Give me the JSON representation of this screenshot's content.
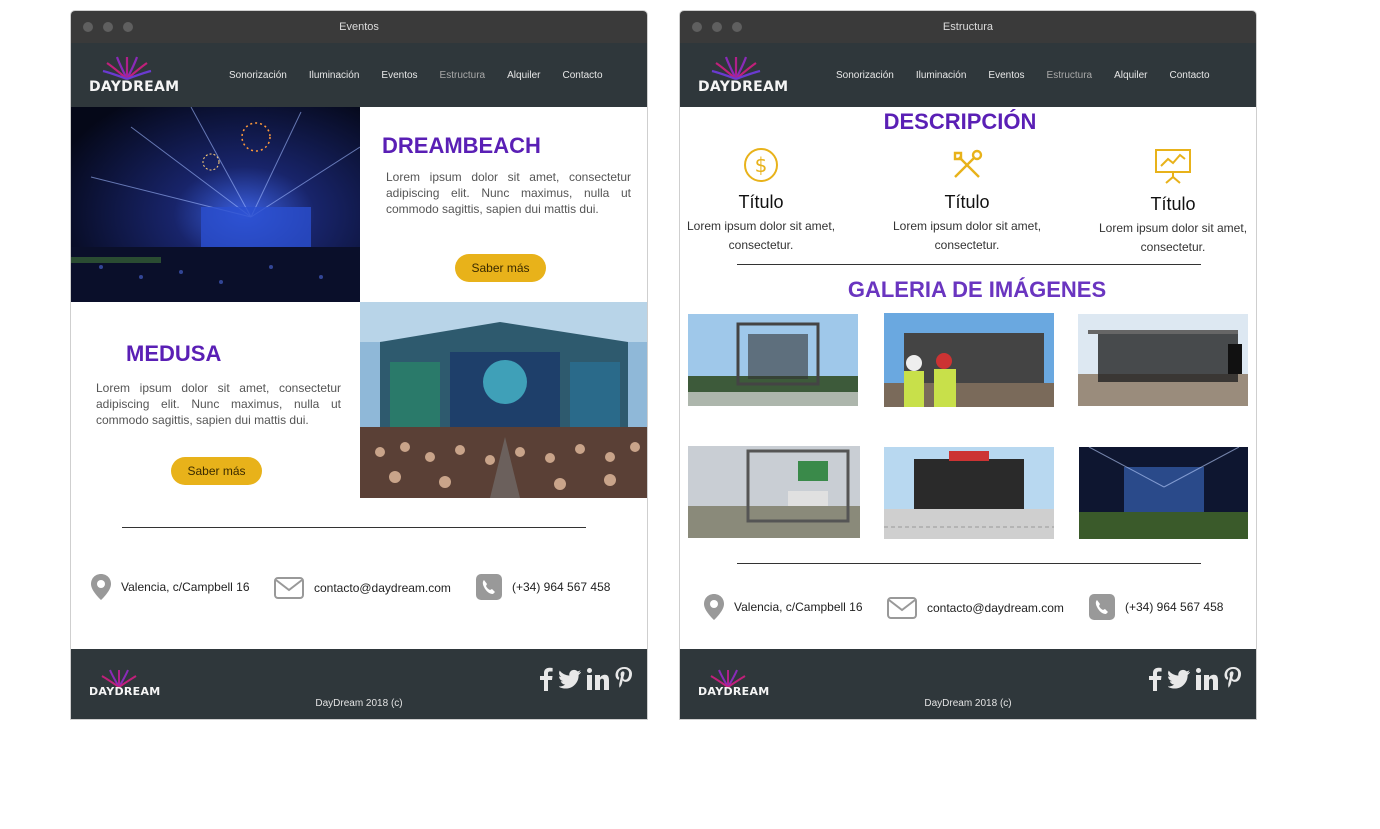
{
  "brand": "DAYDREAM",
  "colors": {
    "accent": "#5a1fb5",
    "button": "#e8b21a",
    "nav": "#2f373b",
    "titlebar": "#3a3a3a"
  },
  "nav_items": [
    "Sonorización",
    "Iluminación",
    "Eventos",
    "Estructura",
    "Alquiler",
    "Contacto"
  ],
  "contact": {
    "address": "Valencia, c/Campbell 16",
    "email": "contacto@daydream.com",
    "phone": "(+34) 964 567 458"
  },
  "footer": {
    "copyright": "DayDream 2018 (c)",
    "social_icons": [
      "facebook-icon",
      "twitter-icon",
      "linkedin-icon",
      "pinterest-icon"
    ]
  },
  "window_a": {
    "title": "Eventos",
    "active_nav": "Eventos",
    "dreambeach": {
      "title": "DREAMBEACH",
      "text": "Lorem ipsum dolor sit amet, consectetur adipiscing elit. Nunc maximus, nulla ut commodo sagittis, sapien dui mattis dui.",
      "button": "Saber más"
    },
    "medusa": {
      "title": "MEDUSA",
      "text": "Lorem ipsum dolor sit amet, consectetur adipiscing elit. Nunc maximus, nulla ut commodo sagittis, sapien dui mattis dui.",
      "button": "Saber más"
    }
  },
  "window_b": {
    "title": "Estructura",
    "active_nav": "Estructura",
    "description_heading": "DESCRIPCIÓN",
    "features": [
      {
        "icon": "dollar-icon",
        "title": "Título",
        "text": "Lorem ipsum dolor sit amet, consectetur."
      },
      {
        "icon": "tools-icon",
        "title": "Título",
        "text": "Lorem ipsum dolor sit amet, consectetur."
      },
      {
        "icon": "presentation-icon",
        "title": "Título",
        "text": "Lorem ipsum dolor sit amet, consectetur."
      }
    ],
    "gallery_heading": "GALERIA DE IMÁGENES",
    "gallery_count": 6
  }
}
